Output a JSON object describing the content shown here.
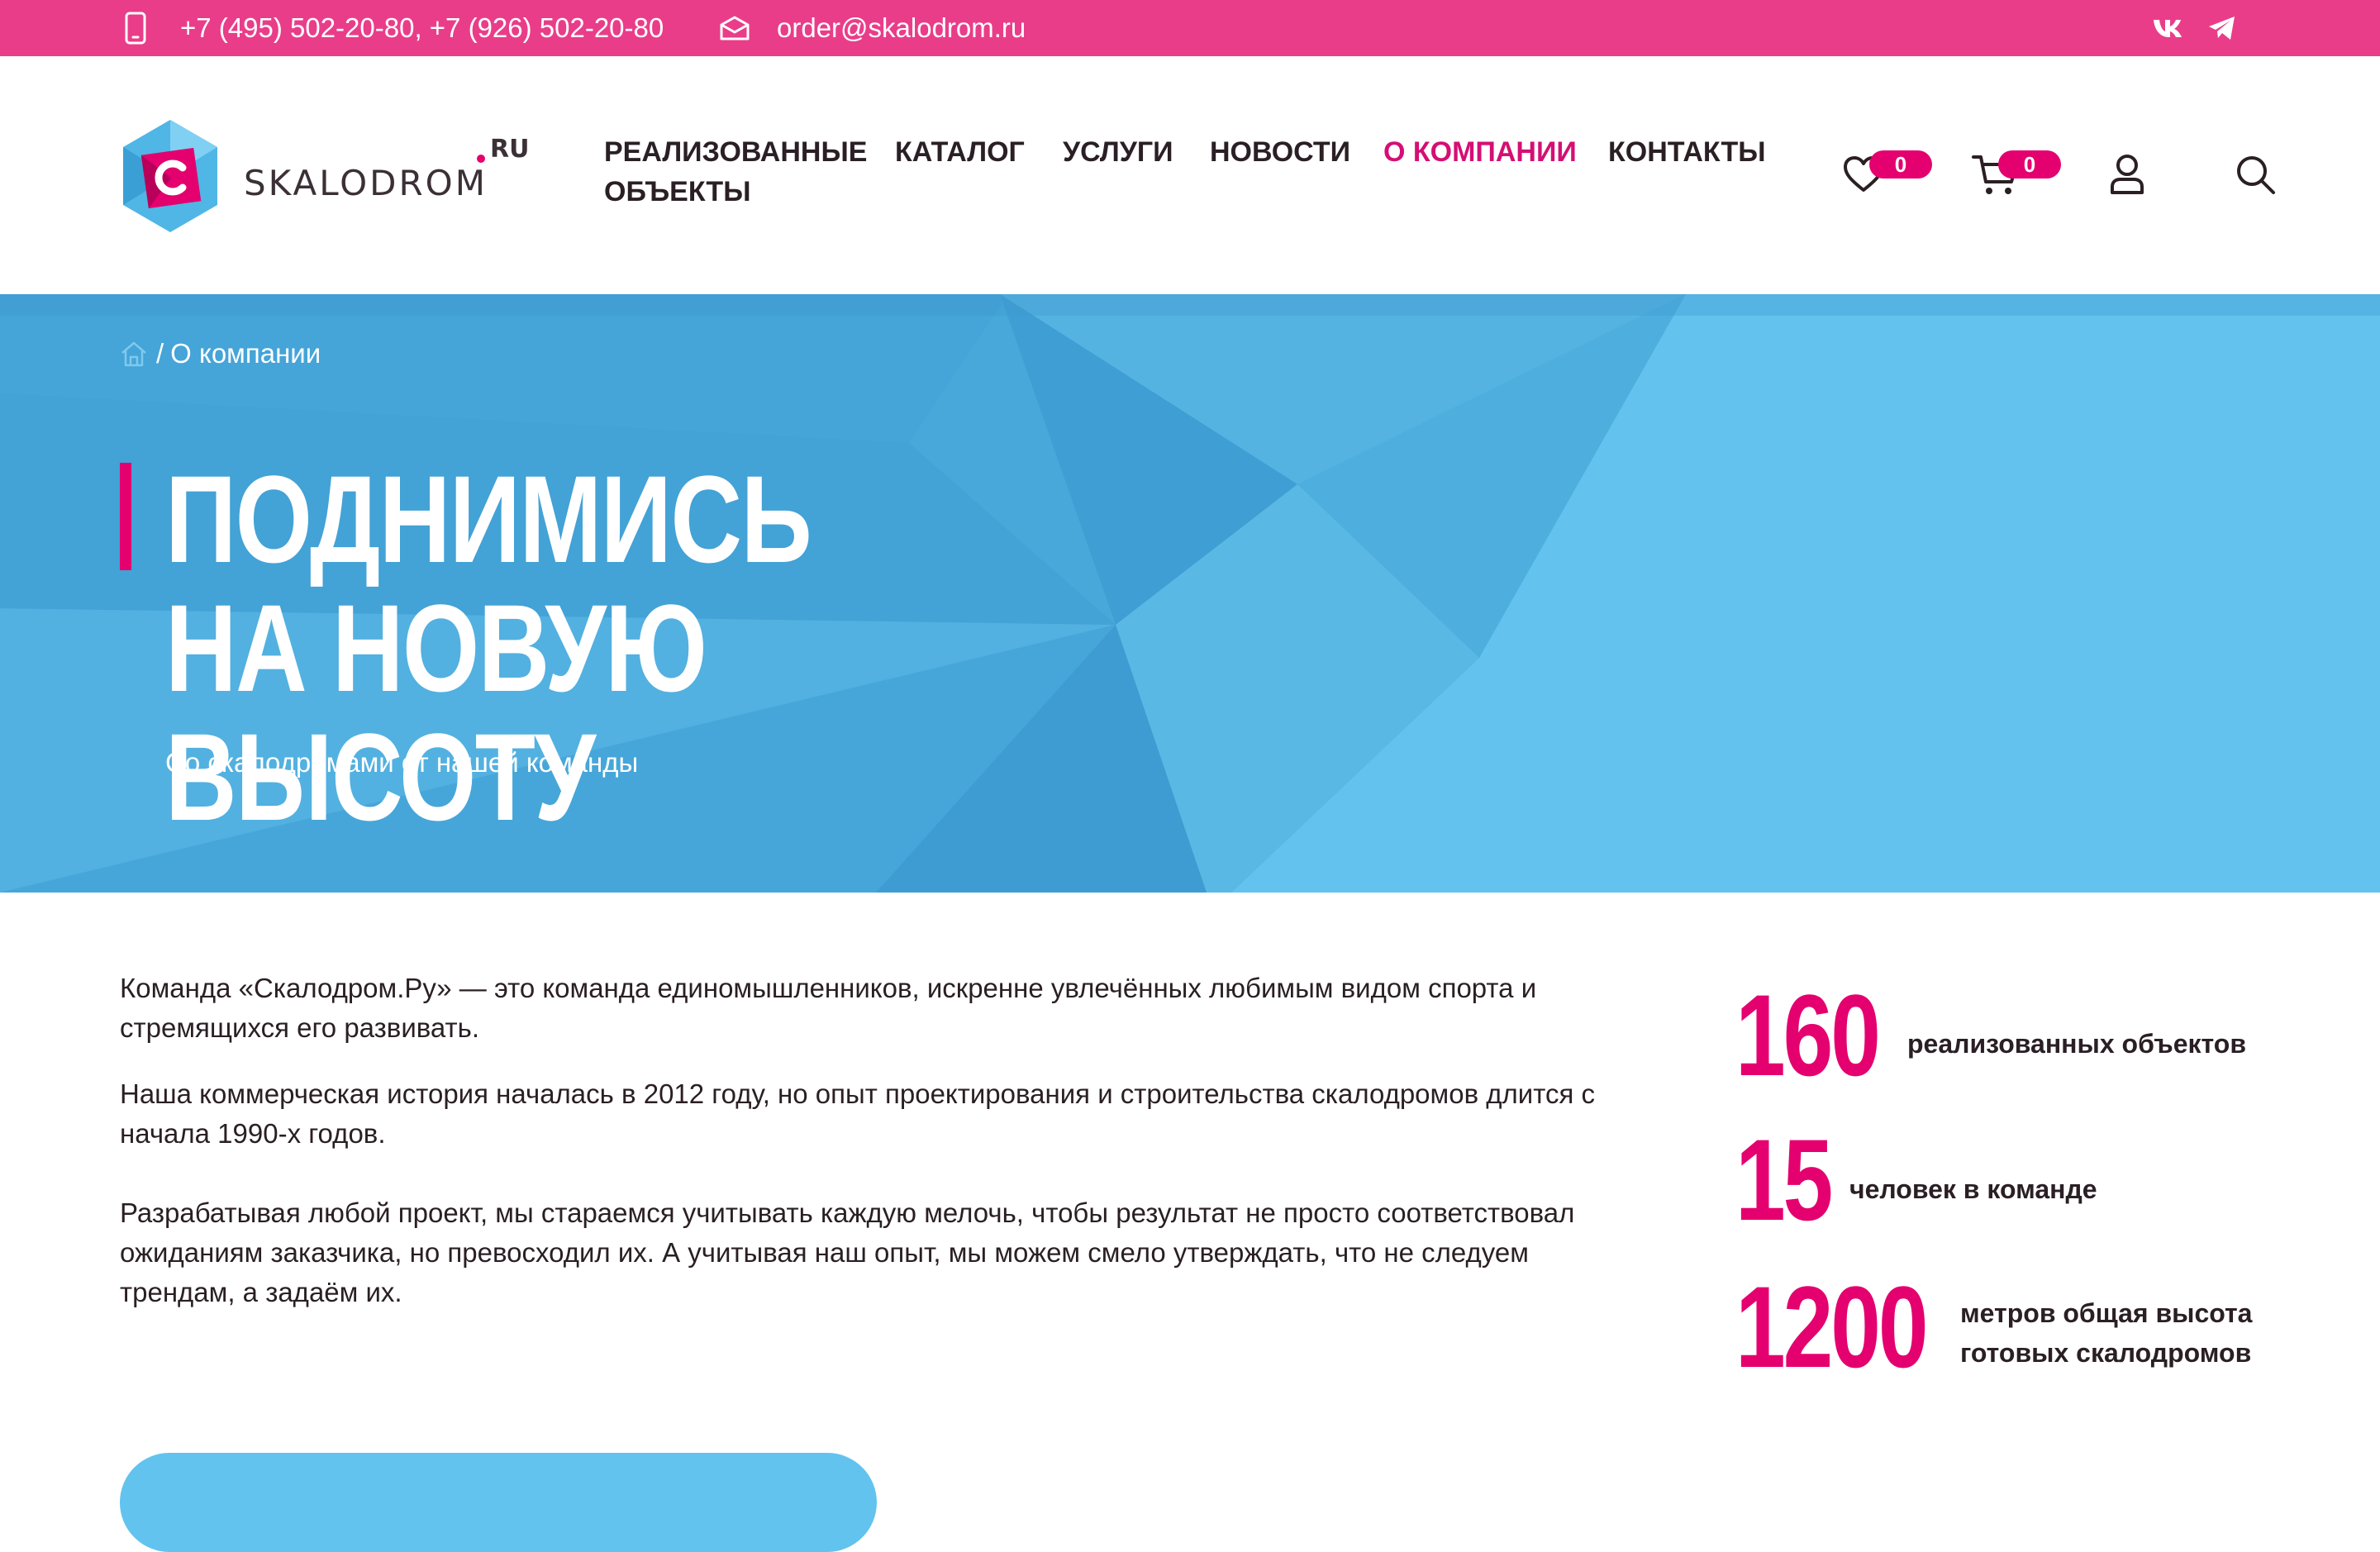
{
  "topbar": {
    "phones": "+7 (495) 502-20-80, +7 (926) 502-20-80",
    "email": "order@skalodrom.ru",
    "social": {
      "vk": "vk",
      "telegram_icon": "telegram-icon"
    },
    "color": "#e93d8a"
  },
  "header": {
    "logo": {
      "name": "SKALODROM",
      "suffix": "RU",
      "letter": "С"
    },
    "nav": [
      {
        "label": "РЕАЛИЗОВАННЫЕ ОБЪЕКТЫ",
        "active": false
      },
      {
        "label": "КАТАЛОГ",
        "active": false
      },
      {
        "label": "УСЛУГИ",
        "active": false
      },
      {
        "label": "НОВОСТИ",
        "active": false
      },
      {
        "label": "О КОМПАНИИ",
        "active": true
      },
      {
        "label": "КОНТАКТЫ",
        "active": false
      }
    ],
    "favorites_count": "0",
    "cart_count": "0",
    "icons": [
      "heart-icon",
      "cart-icon",
      "user-icon",
      "search-icon"
    ]
  },
  "hero": {
    "breadcrumb": {
      "separator": "/",
      "current": "О компании"
    },
    "title": "ПОДНИМИСЬ НА НОВУЮ ВЫСОТУ",
    "subtitle": "Со скалодромами от нашей команды",
    "bg_color": "#4aa8da"
  },
  "about": {
    "paragraphs": [
      "Команда «Скалодром.Ру» — это команда единомышленников, искренне увлечённых любимым видом спорта и стремящихся его развивать.",
      "Наша коммерческая история началась в 2012 году, но опыт проектирования и строительства скалодромов длится с начала 1990-х годов.",
      "Разрабатывая любой проект, мы стараемся учитывать каждую мелочь, чтобы результат не просто соответствовал ожиданиям заказчика, но превосходил их. А учитывая наш опыт, мы можем смело утверждать, что не следуем трендам, а задаём их."
    ]
  },
  "stats": [
    {
      "number": "160",
      "label": "реализованных объектов"
    },
    {
      "number": "15",
      "label": "человек в команде"
    },
    {
      "number": "1200",
      "label": "метров общая высота готовых скалодромов"
    }
  ],
  "accent_color": "#e4006f"
}
